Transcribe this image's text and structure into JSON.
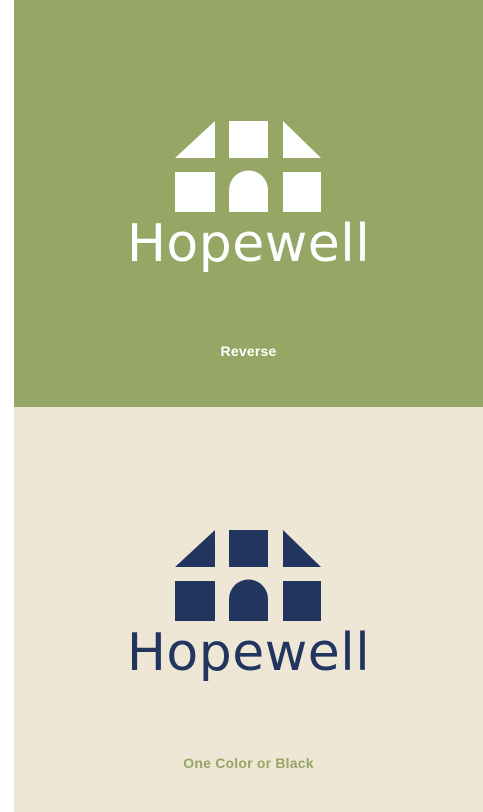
{
  "colors": {
    "green": "#96a664",
    "cream": "#efe7d6",
    "navy": "#22355f",
    "white": "#ffffff"
  },
  "reverse": {
    "wordmark": "Hopewell",
    "caption": "Reverse",
    "mark_icon": "house-window-mark-icon"
  },
  "one_color": {
    "wordmark": "Hopewell",
    "caption": "One Color or Black",
    "mark_icon": "house-window-mark-icon"
  }
}
